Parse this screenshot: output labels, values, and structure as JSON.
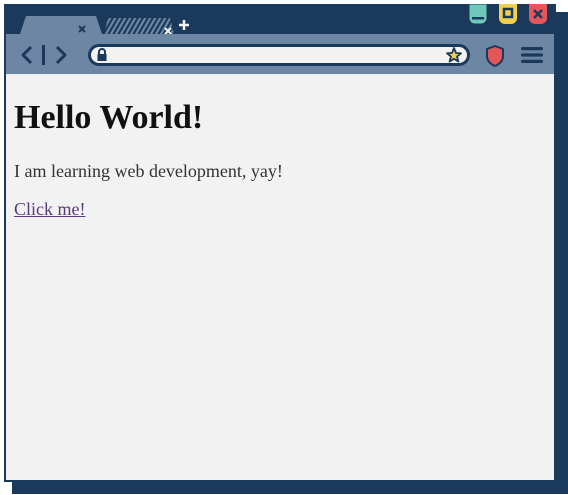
{
  "browser": {
    "tabs": [
      {
        "active": true
      },
      {
        "active": false
      }
    ],
    "url": {
      "value": "",
      "placeholder": ""
    },
    "window_buttons": [
      "minimize-icon",
      "maximize-icon",
      "close-icon"
    ],
    "colors": {
      "frame": "#1b3a5b",
      "toolbar": "#6d86a3",
      "minimize": "#6fc9b8",
      "maximize": "#f2d04a",
      "close": "#e6555a",
      "shield": "#e6555a",
      "star": "#f2d04a"
    }
  },
  "page": {
    "heading": "Hello World!",
    "paragraph": "I am learning web development, yay!",
    "link": "Click me!"
  }
}
